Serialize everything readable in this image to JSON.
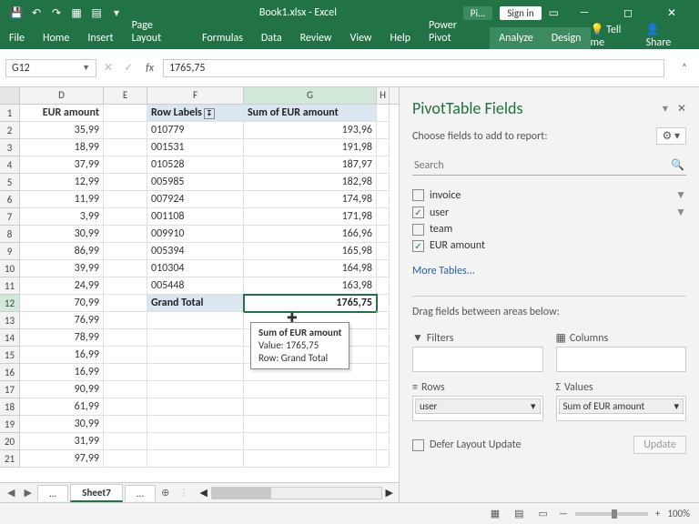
{
  "title": "Book1.xlsx - Excel",
  "context_tab": "Pi...",
  "signin": "Sign in",
  "ribbon": {
    "tabs": [
      "File",
      "Home",
      "Insert",
      "Page Layout",
      "Formulas",
      "Data",
      "Review",
      "View",
      "Help",
      "Power Pivot",
      "Analyze",
      "Design"
    ],
    "tellme": "Tell me",
    "share": "Share"
  },
  "namebox": "G12",
  "formula": "1765,75",
  "columns": [
    "D",
    "E",
    "F",
    "G",
    "H"
  ],
  "rows": [
    {
      "n": 1,
      "D": "EUR amount",
      "E": "",
      "F": "Row Labels",
      "G": "Sum of EUR amount",
      "H": "",
      "hdr": true
    },
    {
      "n": 2,
      "D": "35,99",
      "E": "",
      "F": "010779",
      "G": "193,96",
      "H": ""
    },
    {
      "n": 3,
      "D": "18,99",
      "E": "",
      "F": "001531",
      "G": "191,98",
      "H": ""
    },
    {
      "n": 4,
      "D": "37,99",
      "E": "",
      "F": "010528",
      "G": "187,97",
      "H": ""
    },
    {
      "n": 5,
      "D": "12,99",
      "E": "",
      "F": "005985",
      "G": "182,98",
      "H": ""
    },
    {
      "n": 6,
      "D": "11,99",
      "E": "",
      "F": "007924",
      "G": "174,98",
      "H": ""
    },
    {
      "n": 7,
      "D": "3,99",
      "E": "",
      "F": "001108",
      "G": "171,98",
      "H": ""
    },
    {
      "n": 8,
      "D": "30,99",
      "E": "",
      "F": "009910",
      "G": "166,96",
      "H": ""
    },
    {
      "n": 9,
      "D": "86,99",
      "E": "",
      "F": "005394",
      "G": "165,98",
      "H": ""
    },
    {
      "n": 10,
      "D": "39,99",
      "E": "",
      "F": "010304",
      "G": "164,98",
      "H": ""
    },
    {
      "n": 11,
      "D": "24,99",
      "E": "",
      "F": "005448",
      "G": "163,98",
      "H": ""
    },
    {
      "n": 12,
      "D": "70,99",
      "E": "",
      "F": "Grand Total",
      "G": "1765,75",
      "H": "",
      "total": true,
      "sel": true
    },
    {
      "n": 13,
      "D": "76,99",
      "E": "",
      "F": "",
      "G": "",
      "H": ""
    },
    {
      "n": 14,
      "D": "78,99",
      "E": "",
      "F": "",
      "G": "",
      "H": ""
    },
    {
      "n": 15,
      "D": "16,99",
      "E": "",
      "F": "",
      "G": "",
      "H": ""
    },
    {
      "n": 16,
      "D": "16,99",
      "E": "",
      "F": "",
      "G": "",
      "H": ""
    },
    {
      "n": 17,
      "D": "90,99",
      "E": "",
      "F": "",
      "G": "",
      "H": ""
    },
    {
      "n": 18,
      "D": "61,99",
      "E": "",
      "F": "",
      "G": "",
      "H": ""
    },
    {
      "n": 19,
      "D": "30,99",
      "E": "",
      "F": "",
      "G": "",
      "H": ""
    },
    {
      "n": 20,
      "D": "31,99",
      "E": "",
      "F": "",
      "G": "",
      "H": ""
    },
    {
      "n": 21,
      "D": "97,99",
      "E": "",
      "F": "",
      "G": "",
      "H": ""
    }
  ],
  "tooltip": {
    "title": "Sum of EUR amount",
    "value": "Value: 1765,75",
    "row": "Row: Grand Total"
  },
  "sheets": {
    "left": "...",
    "active": "Sheet7",
    "right": "...",
    "add": "⊕"
  },
  "pane": {
    "title": "PivotTable Fields",
    "sub": "Choose fields to add to report:",
    "search": "Search",
    "fields": [
      {
        "label": "invoice",
        "checked": false,
        "filter": true
      },
      {
        "label": "user",
        "checked": true,
        "filter": true
      },
      {
        "label": "team",
        "checked": false,
        "filter": false
      },
      {
        "label": "EUR amount",
        "checked": true,
        "filter": false
      }
    ],
    "more": "More Tables...",
    "drag": "Drag fields between areas below:",
    "filters_label": "Filters",
    "columns_label": "Columns",
    "rows_label": "Rows",
    "values_label": "Values",
    "rows_token": "user",
    "values_token": "Sum of EUR amount",
    "defer": "Defer Layout Update",
    "update": "Update"
  },
  "status": {
    "zoom": "100%"
  }
}
